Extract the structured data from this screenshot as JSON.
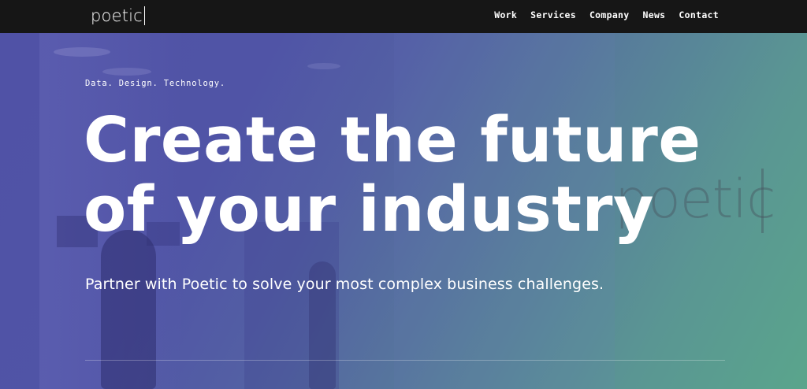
{
  "header": {
    "logo_text": "poetic",
    "nav": [
      {
        "label": "Work"
      },
      {
        "label": "Services"
      },
      {
        "label": "Company"
      },
      {
        "label": "News"
      },
      {
        "label": "Contact"
      }
    ]
  },
  "hero": {
    "tagline": "Data. Design. Technology.",
    "headline_line1": "Create the future",
    "headline_line2": "of your industry",
    "subtext": "Partner with Poetic to solve your most complex business challenges.",
    "wall_logo_text": "poetic"
  },
  "colors": {
    "topbar": "#161616",
    "gradient_start": "#5052a6",
    "gradient_end": "#5aa58c",
    "text": "#ffffff"
  }
}
